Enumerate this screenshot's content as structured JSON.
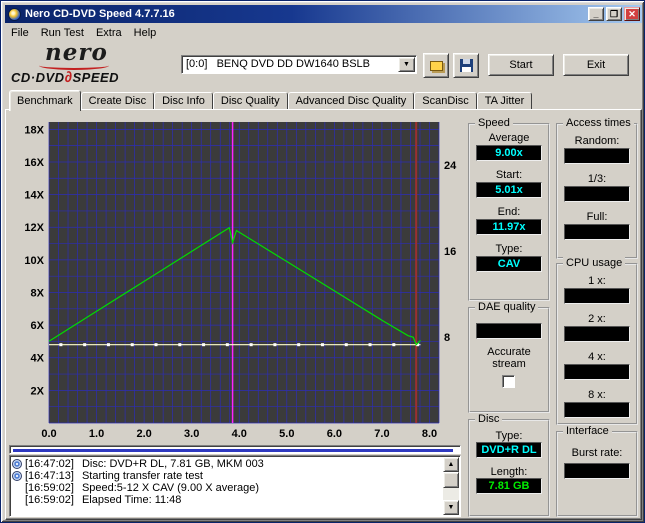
{
  "window": {
    "title": "Nero CD-DVD Speed 4.7.7.16",
    "buttons": {
      "minimize": "_",
      "maximize": "❐",
      "close": "✕"
    }
  },
  "icons": {
    "dropdown": "▼",
    "scroll_up": "▲",
    "scroll_down": "▼"
  },
  "menu": {
    "items": [
      "File",
      "Run Test",
      "Extra",
      "Help"
    ]
  },
  "logo": {
    "brand": "nero",
    "product_left": "CD·DVD",
    "product_symbol": "∂",
    "product_right": "SPEED"
  },
  "toolbar": {
    "drive": "[0:0]   BENQ DVD DD DW1640 BSLB",
    "start": "Start",
    "exit": "Exit"
  },
  "tabs": {
    "items": [
      "Benchmark",
      "Create Disc",
      "Disc Info",
      "Disc Quality",
      "Advanced Disc Quality",
      "ScanDisc",
      "TA Jitter"
    ],
    "active": "Benchmark"
  },
  "speed_panel": {
    "title": "Speed",
    "average_label": "Average",
    "average": "9.00x",
    "start_label": "Start:",
    "start": "5.01x",
    "end_label": "End:",
    "end": "11.97x",
    "type_label": "Type:",
    "type": "CAV"
  },
  "access_panel": {
    "title": "Access times",
    "random_label": "Random:",
    "random": "",
    "third_label": "1/3:",
    "third": "",
    "full_label": "Full:",
    "full": ""
  },
  "dae_panel": {
    "title": "DAE quality",
    "value": "",
    "accurate_line1": "Accurate",
    "accurate_line2": "stream"
  },
  "cpu_panel": {
    "title": "CPU usage",
    "rows": [
      {
        "label": "1 x:",
        "value": ""
      },
      {
        "label": "2 x:",
        "value": ""
      },
      {
        "label": "4 x:",
        "value": ""
      },
      {
        "label": "8 x:",
        "value": ""
      }
    ]
  },
  "disc_panel": {
    "title": "Disc",
    "type_label": "Type:",
    "type": "DVD+R DL",
    "length_label": "Length:",
    "length": "7.81 GB"
  },
  "interface_panel": {
    "title": "Interface",
    "burst_label": "Burst rate:",
    "burst": ""
  },
  "log": {
    "entries": [
      {
        "time": "[16:47:02]",
        "text": "Disc: DVD+R DL, 7.81 GB, MKM 003",
        "icon": true
      },
      {
        "time": "[16:47:13]",
        "text": "Starting transfer rate test",
        "icon": true
      },
      {
        "time": "[16:59:02]",
        "text": "Speed:5-12 X CAV (9.00 X average)",
        "icon": false
      },
      {
        "time": "[16:59:02]",
        "text": "Elapsed Time: 11:48",
        "icon": false
      }
    ]
  },
  "chart_data": {
    "type": "line",
    "x_axis": {
      "min": 0,
      "max": 8.2,
      "ticks": [
        {
          "v": 0,
          "label": "0.0"
        },
        {
          "v": 1,
          "label": "1.0"
        },
        {
          "v": 2,
          "label": "2.0"
        },
        {
          "v": 3,
          "label": "3.0"
        },
        {
          "v": 4,
          "label": "4.0"
        },
        {
          "v": 5,
          "label": "5.0"
        },
        {
          "v": 6,
          "label": "6.0"
        },
        {
          "v": 7,
          "label": "7.0"
        },
        {
          "v": 8,
          "label": "8.0"
        }
      ]
    },
    "y_left": {
      "min": 0,
      "max": 18.45,
      "ticks": [
        {
          "v": 18,
          "label": "18X"
        },
        {
          "v": 16,
          "label": "16X"
        },
        {
          "v": 14,
          "label": "14X"
        },
        {
          "v": 12,
          "label": "12X"
        },
        {
          "v": 10,
          "label": "10X"
        },
        {
          "v": 8,
          "label": "8X"
        },
        {
          "v": 6,
          "label": "6X"
        },
        {
          "v": 4,
          "label": "4X"
        },
        {
          "v": 2,
          "label": "2X"
        }
      ]
    },
    "y_right": {
      "min": 0,
      "max": 28,
      "ticks": [
        {
          "v": 24,
          "label": "24"
        },
        {
          "v": 16,
          "label": "16"
        },
        {
          "v": 8,
          "label": "8"
        }
      ]
    },
    "grid": {
      "x_step": 0.2,
      "y_step": 1,
      "color": "#2d2db6"
    },
    "plot_bg": "#3b3b3b",
    "series": [
      {
        "name": "rotation-speed",
        "color": "#ffffcf",
        "dots": true,
        "dot_color": "#ffffff",
        "points": [
          [
            0,
            4.8
          ],
          [
            7.81,
            4.8
          ]
        ]
      },
      {
        "name": "read-speed",
        "color": "#00dd00",
        "dots": false,
        "points": [
          [
            0,
            5.01
          ],
          [
            1,
            6.85
          ],
          [
            2,
            8.68
          ],
          [
            3,
            10.52
          ],
          [
            3.79,
            11.97
          ],
          [
            3.86,
            11.05
          ],
          [
            3.94,
            11.8
          ],
          [
            5,
            9.9
          ],
          [
            6,
            8.1
          ],
          [
            7,
            6.3
          ],
          [
            7.55,
            5.35
          ],
          [
            7.66,
            5.25
          ],
          [
            7.72,
            4.8
          ],
          [
            7.81,
            5.05
          ]
        ]
      }
    ],
    "markers": [
      {
        "x": 3.86,
        "color": "#ff22ff",
        "w": 1.5
      },
      {
        "x": 7.72,
        "color": "#9b3030",
        "w": 2
      }
    ]
  }
}
